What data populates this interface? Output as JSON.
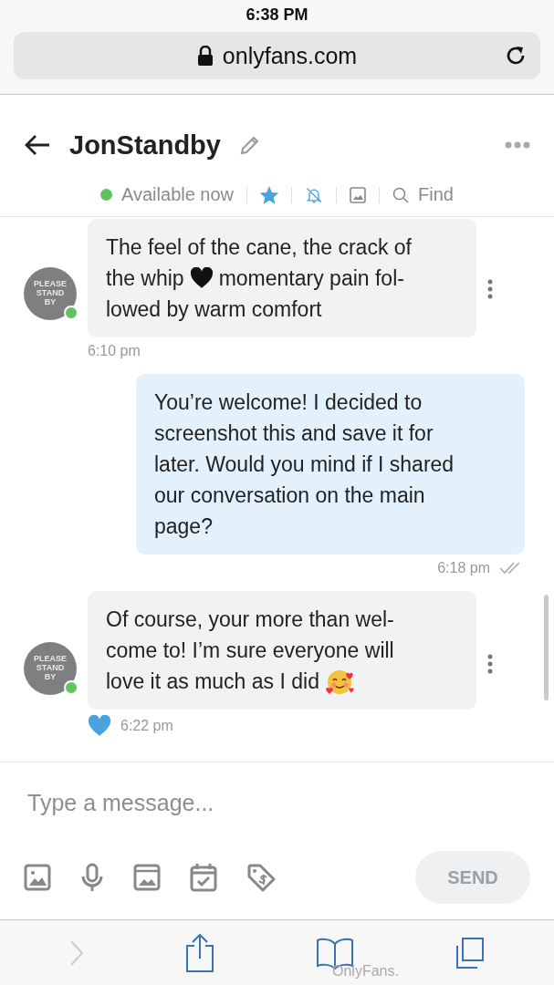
{
  "status_bar": {
    "time": "6:38 PM"
  },
  "address_bar": {
    "url": "onlyfans.com"
  },
  "chat_header": {
    "title": "JonStandby",
    "availability": "Available now",
    "online": true,
    "favorite": true,
    "find_label": "Find"
  },
  "messages": [
    {
      "outgoing": false,
      "avatar_text": "PLEASE STAND BY",
      "online": true,
      "lines": [
        [
          {
            "kind": "text",
            "text": "The feel of the cane, the crack of"
          }
        ],
        [
          {
            "kind": "text",
            "text": "the whip"
          },
          {
            "kind": "heart-emoji"
          },
          {
            "kind": "text",
            "text": "momentary pain fol-"
          }
        ],
        [
          {
            "kind": "text",
            "text": "lowed by warm comfort"
          }
        ]
      ],
      "time": "6:10 pm",
      "liked": false,
      "read": false
    },
    {
      "outgoing": true,
      "lines": [
        [
          {
            "kind": "text",
            "text": "You’re welcome! I decided to"
          }
        ],
        [
          {
            "kind": "text",
            "text": "screenshot this and save it for"
          }
        ],
        [
          {
            "kind": "text",
            "text": "later. Would you mind if I shared"
          }
        ],
        [
          {
            "kind": "text",
            "text": "our conversation on the main"
          }
        ],
        [
          {
            "kind": "text",
            "text": "page?"
          }
        ]
      ],
      "time": "6:18 pm",
      "liked": false,
      "read": true
    },
    {
      "outgoing": false,
      "avatar_text": "PLEASE STAND BY",
      "online": true,
      "lines": [
        [
          {
            "kind": "text",
            "text": "Of course, your more than wel-"
          }
        ],
        [
          {
            "kind": "text",
            "text": "come to! I’m sure everyone will"
          }
        ],
        [
          {
            "kind": "text",
            "text": "love it as much as I did"
          },
          {
            "kind": "smile-emoji"
          }
        ]
      ],
      "time": "6:22 pm",
      "liked": true,
      "read": false
    }
  ],
  "composer": {
    "placeholder": "Type a message...",
    "send_label": "SEND",
    "send_disabled": true
  },
  "browser_toolbar": {
    "footer_text": "OnlyFans."
  }
}
